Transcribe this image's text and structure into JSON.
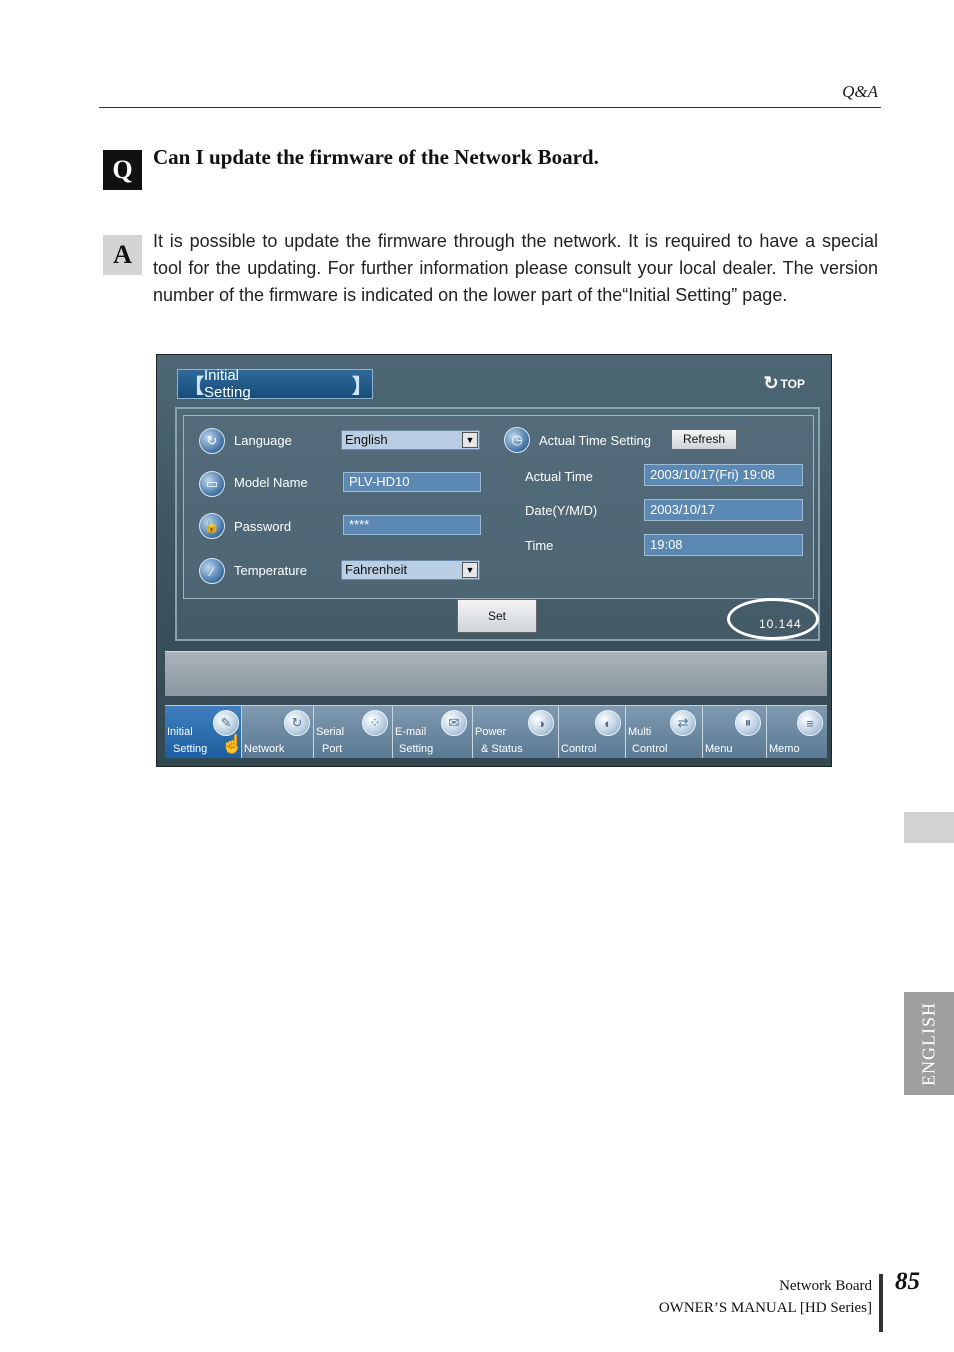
{
  "header": {
    "section": "Q&A"
  },
  "qa": {
    "q_badge": "Q",
    "question": "Can I update the firmware of the Network Board.",
    "a_badge": "A",
    "answer": "It is possible to update the firmware through the network. It is required to have a special tool for the updating. For further information please consult your local dealer. The version number of the firmware is indicated on the lower part of the“Initial Setting” page."
  },
  "screenshot": {
    "title": "Initial Setting",
    "top_link": "TOP",
    "fields": {
      "language_label": "Language",
      "language_value": "English",
      "model_label": "Model Name",
      "model_value": "PLV-HD10",
      "password_label": "Password",
      "password_value": "****",
      "temperature_label": "Temperature",
      "temperature_value": "Fahrenheit",
      "actual_time_setting_label": "Actual Time Setting",
      "refresh_button": "Refresh",
      "actual_time_label": "Actual Time",
      "actual_time_value": "2003/10/17(Fri) 19:08",
      "date_label": "Date(Y/M/D)",
      "date_value": "2003/10/17",
      "time_label": "Time",
      "time_value": "19:08"
    },
    "set_button": "Set",
    "version": "10.144",
    "nav": [
      {
        "l1": "Initial",
        "l2": "Setting",
        "icon": "pen-icon"
      },
      {
        "l1": "",
        "l2": "Network",
        "icon": "refresh-icon"
      },
      {
        "l1": "Serial",
        "l2": "Port",
        "icon": "serial-port-icon"
      },
      {
        "l1": "E-mail",
        "l2": "Setting",
        "icon": "mail-icon"
      },
      {
        "l1": "Power",
        "l2": "& Status",
        "icon": "power-icon"
      },
      {
        "l1": "",
        "l2": "Control",
        "icon": "control-icon"
      },
      {
        "l1": "Multi",
        "l2": "Control",
        "icon": "multi-control-icon"
      },
      {
        "l1": "",
        "l2": "Menu",
        "icon": "menu-icon"
      },
      {
        "l1": "",
        "l2": "Memo",
        "icon": "memo-icon"
      }
    ]
  },
  "side_tab": "ENGLISH",
  "footer": {
    "line1": "Network Board",
    "line2": "OWNER’S MANUAL [HD Series]",
    "page": "85"
  }
}
